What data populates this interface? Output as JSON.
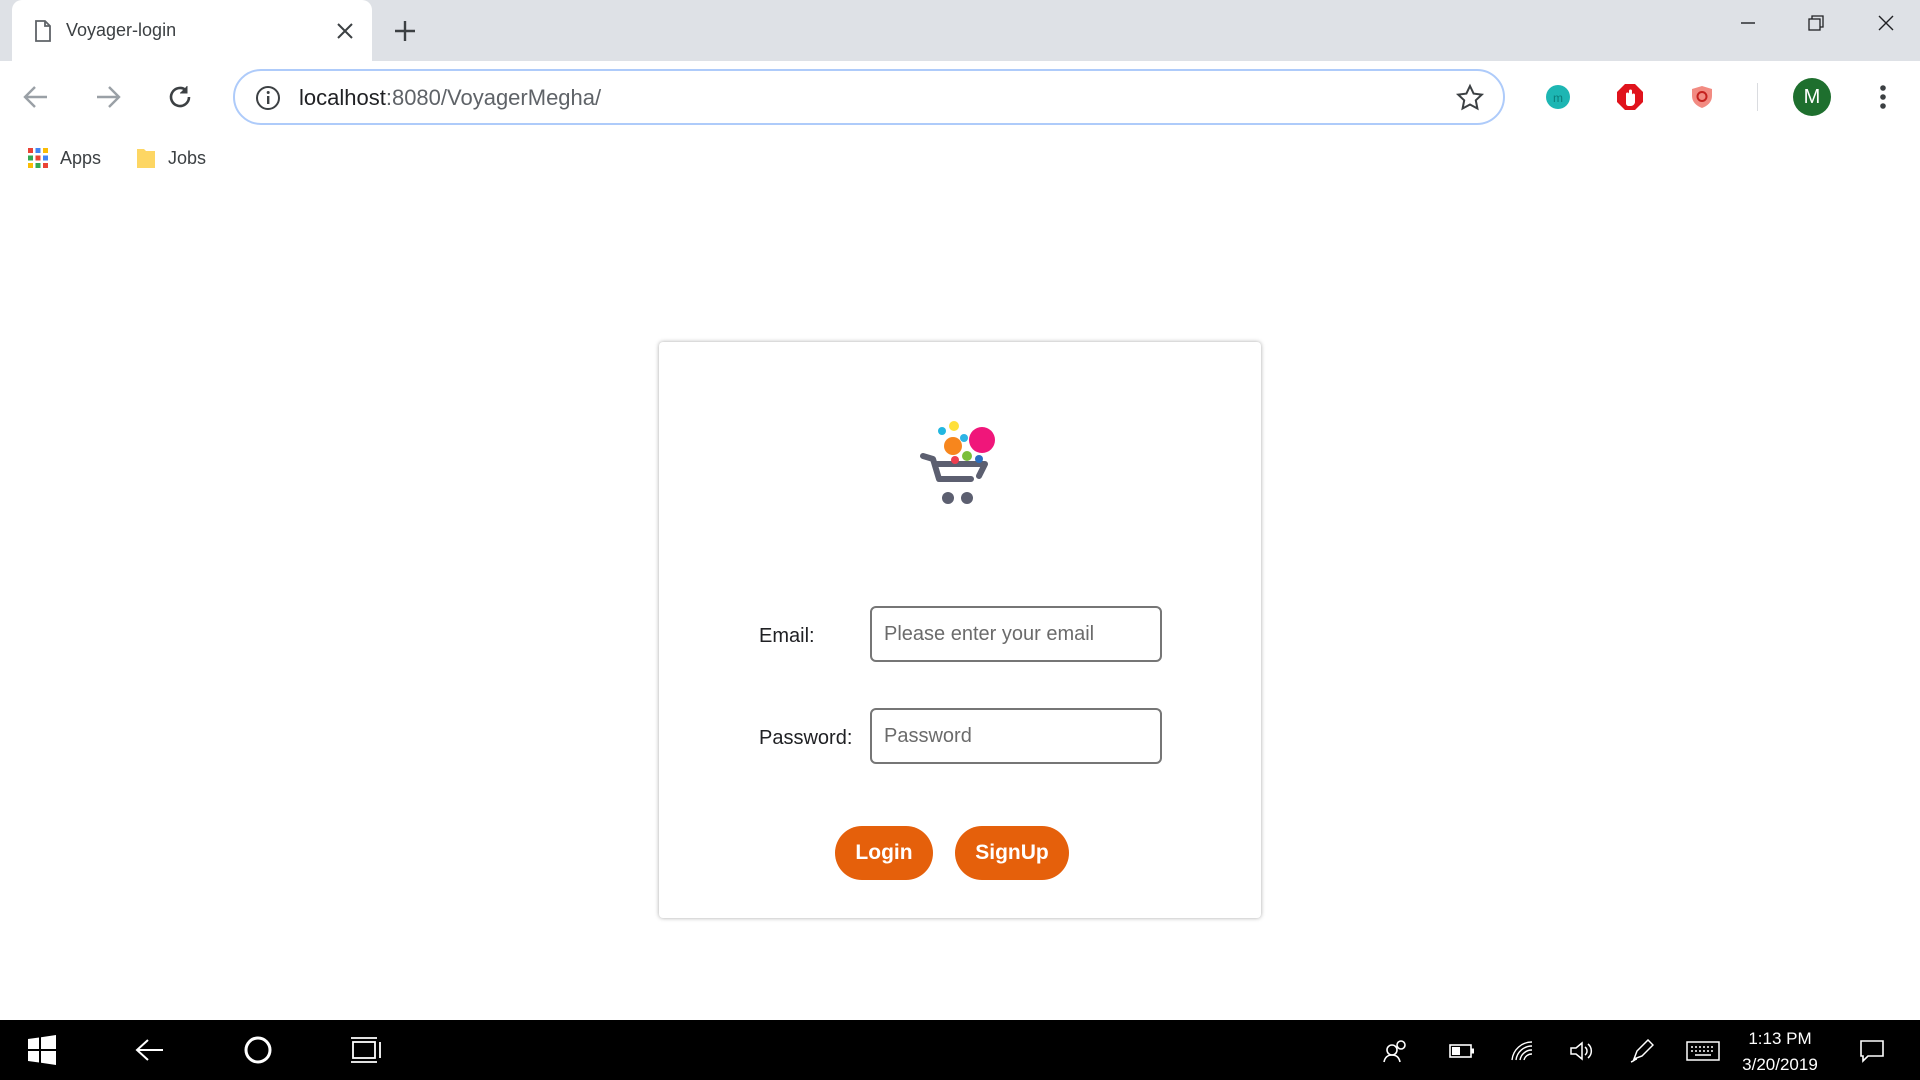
{
  "browser": {
    "tab_title": "Voyager-login",
    "url_host": "localhost",
    "url_path": ":8080/VoyagerMegha/",
    "avatar_letter": "M",
    "bookmarks": [
      {
        "label": "Apps",
        "icon": "apps-grid-icon"
      },
      {
        "label": "Jobs",
        "icon": "folder-icon"
      }
    ]
  },
  "login": {
    "email_label": "Email:",
    "email_placeholder": "Please enter your email",
    "email_value": "",
    "password_label": "Password:",
    "password_placeholder": "Password",
    "password_value": "",
    "login_button": "Login",
    "signup_button": "SignUp",
    "accent_color": "#e5600b"
  },
  "taskbar": {
    "time": "1:13 PM",
    "date": "3/20/2019"
  }
}
